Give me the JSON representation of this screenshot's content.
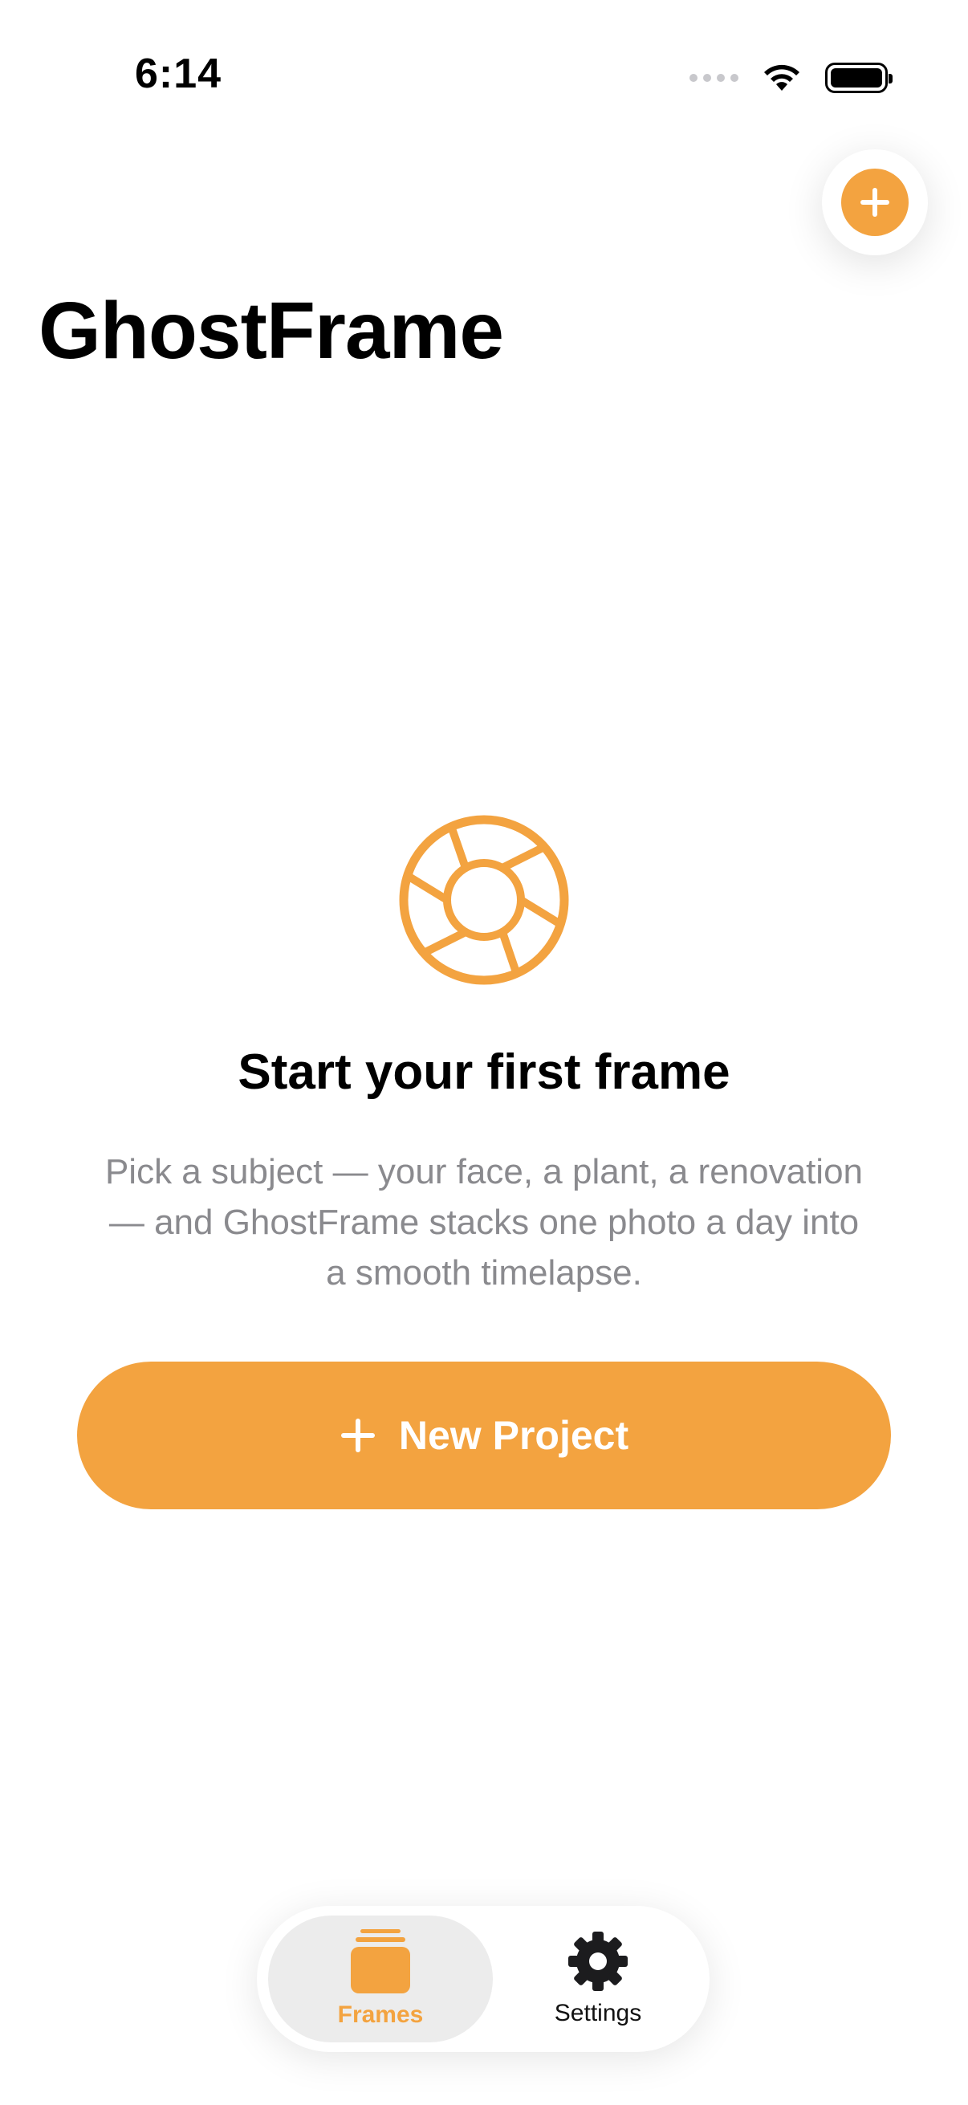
{
  "status_bar": {
    "time": "6:14"
  },
  "header": {
    "title": "GhostFrame"
  },
  "empty_state": {
    "icon": "aperture-icon",
    "title": "Start your first frame",
    "description": "Pick a subject — your face, a plant, a renovation — and GhostFrame stacks one photo a day into a smooth timelapse.",
    "button_label": "New Project"
  },
  "tab_bar": {
    "tabs": [
      {
        "label": "Frames",
        "icon": "frames-stack-icon",
        "selected": true
      },
      {
        "label": "Settings",
        "icon": "gear-icon",
        "selected": false
      }
    ]
  },
  "colors": {
    "accent": "#f3a340",
    "secondary_text": "#8a8a8e",
    "selected_tab_bg": "#ececec"
  }
}
